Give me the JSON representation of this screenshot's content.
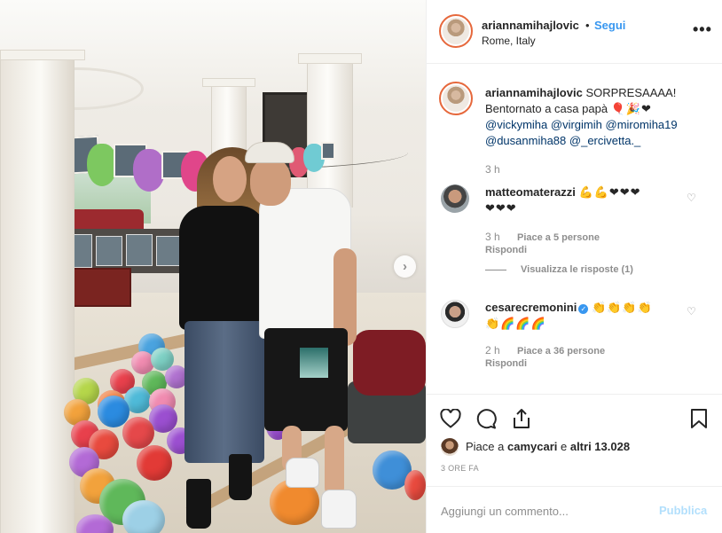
{
  "post": {
    "username": "ariannamihajlovic",
    "separator": "•",
    "follow_label": "Segui",
    "location": "Rome, Italy",
    "more_icon": "more-horizontal-icon"
  },
  "caption": {
    "username": "ariannamihajlovic",
    "text_1": "SORPRESAAAA!",
    "text_2": "Bentornato a casa papà",
    "emojis": "🎈🎉❤",
    "mentions": [
      "@vickymiha",
      "@virgimih",
      "@miromiha19",
      "@dusanmiha88",
      "@_ercivetta._"
    ],
    "time": "3 h"
  },
  "comments": [
    {
      "username": "matteomaterazzi",
      "emojis_1": "💪💪❤❤❤",
      "emojis_2": "❤❤❤",
      "time": "3 h",
      "likes": "Piace a 5 persone",
      "reply": "Rispondi",
      "view_replies": "Visualizza le risposte (1)"
    },
    {
      "username": "cesarecremonini",
      "verified": true,
      "emojis_1": "👏👏👏👏",
      "emojis_2": "👏🌈🌈🌈",
      "time": "2 h",
      "likes": "Piace a 36 persone",
      "reply": "Rispondi"
    }
  ],
  "actions": {
    "like_icon": "heart-icon",
    "comment_icon": "comment-icon",
    "share_icon": "share-icon",
    "save_icon": "bookmark-icon"
  },
  "likes_summary": {
    "prefix": "Piace a ",
    "first_user": "camycari",
    "middle": " e ",
    "others": "altri 13.028"
  },
  "posted": "3 ORE FA",
  "comment_box": {
    "placeholder": "Aggiungi un commento...",
    "publish_label": "Pubblica"
  },
  "colors": {
    "accent": "#3897f0",
    "text": "#262626",
    "muted": "#8e8e8e",
    "publish_disabled": "#b2dffc",
    "divider": "#efefef"
  }
}
